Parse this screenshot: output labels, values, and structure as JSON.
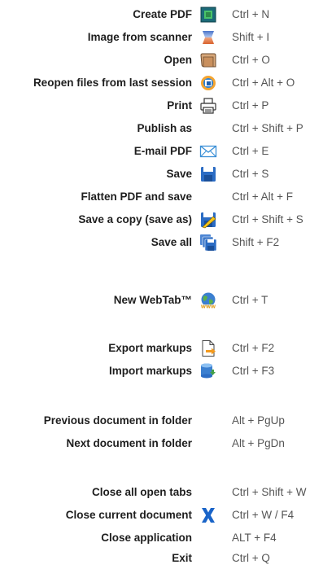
{
  "items": [
    {
      "label": "Create PDF",
      "shortcut": "Ctrl + N",
      "icon": "create-pdf-icon"
    },
    {
      "label": "Image from scanner",
      "shortcut": "Shift + I",
      "icon": "scanner-icon"
    },
    {
      "label": "Open",
      "shortcut": "Ctrl + O",
      "icon": "folder-open-icon"
    },
    {
      "label": "Reopen files from last session",
      "shortcut": "Ctrl + Alt + O",
      "icon": "reopen-session-icon"
    },
    {
      "label": "Print",
      "shortcut": "Ctrl + P",
      "icon": "printer-icon"
    },
    {
      "label": "Publish as",
      "shortcut": "Ctrl + Shift + P",
      "icon": ""
    },
    {
      "label": "E-mail PDF",
      "shortcut": "Ctrl + E",
      "icon": "envelope-icon"
    },
    {
      "label": "Save",
      "shortcut": "Ctrl + S",
      "icon": "save-disk-icon"
    },
    {
      "label": "Flatten PDF and save",
      "shortcut": "Ctrl + Alt + F",
      "icon": ""
    },
    {
      "label": "Save a copy  (save as)",
      "shortcut": "Ctrl + Shift + S",
      "icon": "save-as-icon"
    },
    {
      "label": "Save all",
      "shortcut": "Shift + F2",
      "icon": "save-all-icon"
    },
    {
      "label": "New WebTab™",
      "shortcut": "Ctrl + T",
      "icon": "globe-www-icon"
    },
    {
      "label": "Export markups",
      "shortcut": "Ctrl + F2",
      "icon": "export-markups-icon"
    },
    {
      "label": "Import markups",
      "shortcut": "Ctrl + F3",
      "icon": "import-markups-icon"
    },
    {
      "label": "Previous document in folder",
      "shortcut": "Alt + PgUp",
      "icon": ""
    },
    {
      "label": "Next document in folder",
      "shortcut": "Alt + PgDn",
      "icon": ""
    },
    {
      "label": "Close all open tabs",
      "shortcut": "Ctrl + Shift + W",
      "icon": ""
    },
    {
      "label": "Close current document",
      "shortcut": "Ctrl + W / F4",
      "icon": "close-x-icon"
    },
    {
      "label": "Close application",
      "shortcut": "ALT + F4",
      "icon": ""
    },
    {
      "label": "Exit",
      "shortcut": "Ctrl + Q",
      "icon": ""
    }
  ]
}
